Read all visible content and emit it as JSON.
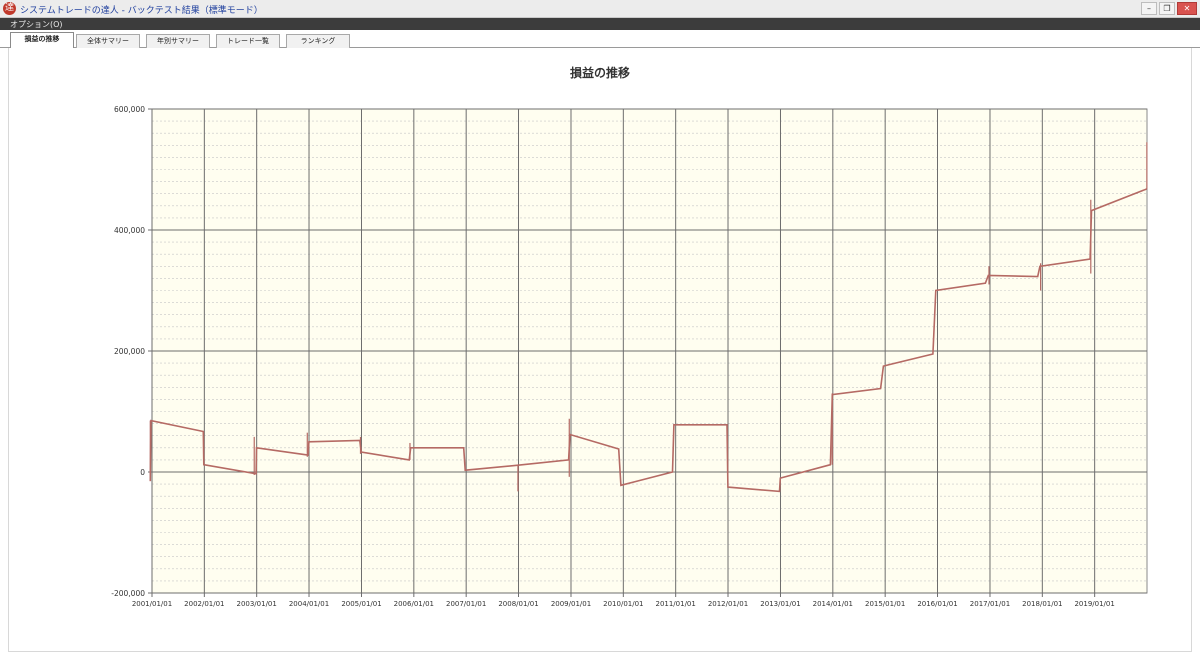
{
  "window": {
    "title": "システムトレードの達人 - バックテスト結果（標準モード）",
    "app_icon_glyph": "達",
    "controls": {
      "minimize": "–",
      "restore": "❐",
      "close": "✕"
    }
  },
  "menubar": {
    "items": [
      "オプション(O)"
    ]
  },
  "tabs": [
    {
      "label": "損益の推移",
      "active": true
    },
    {
      "label": "全体サマリー",
      "active": false
    },
    {
      "label": "年別サマリー",
      "active": false
    },
    {
      "label": "トレード一覧",
      "active": false
    },
    {
      "label": "ランキング",
      "active": false
    }
  ],
  "colors": {
    "plot_background": "#fffef0",
    "line": "#b56a64",
    "grid_major": "#6d6d6d",
    "grid_minor": "#c6c6c6",
    "tab_active_bg": "#ffffff"
  },
  "chart_data": {
    "type": "line",
    "title": "損益の推移",
    "xlabel": "",
    "ylabel": "",
    "x_range": [
      "2001-01-01",
      "2020-01-01"
    ],
    "ylim": [
      -200000,
      600000
    ],
    "y_ticks": [
      -200000,
      0,
      200000,
      400000,
      600000
    ],
    "y_tick_labels": [
      "-200,000",
      "0",
      "200,000",
      "400,000",
      "600,000"
    ],
    "x_tick_labels": [
      "2001/01/01",
      "2002/01/01",
      "2003/01/01",
      "2004/01/01",
      "2005/01/01",
      "2006/01/01",
      "2007/01/01",
      "2008/01/01",
      "2009/01/01",
      "2010/01/01",
      "2011/01/01",
      "2012/01/01",
      "2013/01/01",
      "2014/01/01",
      "2015/01/01",
      "2016/01/01",
      "2017/01/01",
      "2018/01/01",
      "2019/01/01"
    ],
    "grid": true,
    "series": [
      {
        "points": [
          [
            "2000-12-20",
            -15000
          ],
          [
            "2000-12-25",
            85000
          ],
          [
            "2001-12-25",
            67000
          ],
          [
            "2001-12-28",
            12000
          ],
          [
            "2002-12-28",
            -3000
          ],
          [
            "2002-12-31",
            40000
          ],
          [
            "2003-12-25",
            28000
          ],
          [
            "2003-12-31",
            50000
          ],
          [
            "2004-12-20",
            52000
          ],
          [
            "2004-12-30",
            33000
          ],
          [
            "2005-11-30",
            20000
          ],
          [
            "2005-12-10",
            40000
          ],
          [
            "2006-12-15",
            40000
          ],
          [
            "2006-12-25",
            3000
          ],
          [
            "2007-12-20",
            11000
          ],
          [
            "2008-12-15",
            20000
          ],
          [
            "2008-12-25",
            62000
          ],
          [
            "2009-11-30",
            38000
          ],
          [
            "2009-12-15",
            -22000
          ],
          [
            "2010-12-10",
            0
          ],
          [
            "2010-12-20",
            78000
          ],
          [
            "2011-12-25",
            78000
          ],
          [
            "2011-12-31",
            -25000
          ],
          [
            "2012-12-25",
            -32000
          ],
          [
            "2012-12-31",
            -10000
          ],
          [
            "2013-12-15",
            12000
          ],
          [
            "2013-12-28",
            128000
          ],
          [
            "2014-11-30",
            138000
          ],
          [
            "2014-12-20",
            175000
          ],
          [
            "2015-11-30",
            195000
          ],
          [
            "2015-12-20",
            300000
          ],
          [
            "2016-11-30",
            312000
          ],
          [
            "2016-12-20",
            325000
          ],
          [
            "2017-11-30",
            323000
          ],
          [
            "2017-12-15",
            340000
          ],
          [
            "2018-11-30",
            352000
          ],
          [
            "2018-12-10",
            432000
          ],
          [
            "2019-12-31",
            468000
          ]
        ],
        "spikes": [
          [
            "2000-12-20",
            -15000,
            85000
          ],
          [
            "2002-12-15",
            -5000,
            58000
          ],
          [
            "2003-12-20",
            25000,
            65000
          ],
          [
            "2004-12-25",
            30000,
            58000
          ],
          [
            "2005-12-05",
            20000,
            48000
          ],
          [
            "2007-12-28",
            -32000,
            12000
          ],
          [
            "2008-12-20",
            -8000,
            88000
          ],
          [
            "2013-12-28",
            12000,
            130000
          ],
          [
            "2016-12-25",
            310000,
            340000
          ],
          [
            "2017-12-20",
            300000,
            345000
          ],
          [
            "2018-12-05",
            328000,
            450000
          ],
          [
            "2019-12-31",
            468000,
            545000
          ]
        ]
      }
    ]
  }
}
